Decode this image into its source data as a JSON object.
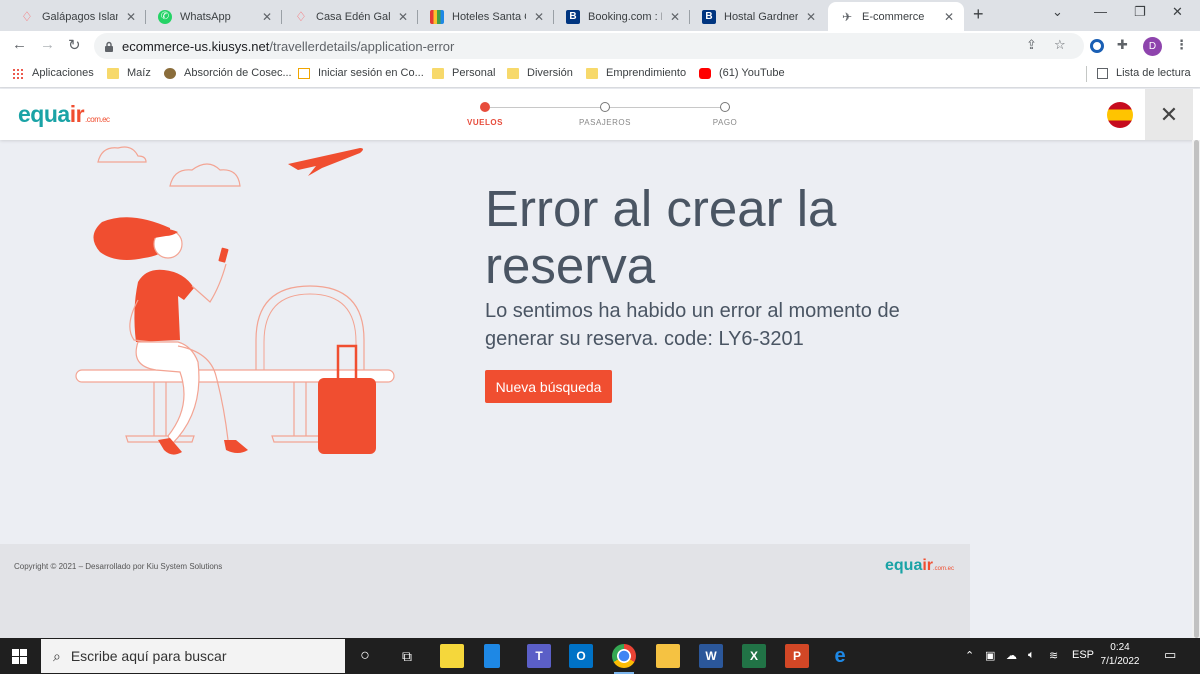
{
  "browser": {
    "tabs": [
      {
        "title": "Galápagos Island",
        "icon": "airbnb-icon"
      },
      {
        "title": "WhatsApp",
        "icon": "whatsapp-icon"
      },
      {
        "title": "Casa Edén Galápa",
        "icon": "airbnb-icon"
      },
      {
        "title": "Hoteles Santa Cr",
        "icon": "hotels-icon"
      },
      {
        "title": "Booking.com : Ho",
        "icon": "booking-icon"
      },
      {
        "title": "Hostal Gardner G",
        "icon": "booking-icon"
      },
      {
        "title": "E-commerce",
        "icon": "plane-icon",
        "active": true
      }
    ],
    "url_host": "ecommerce-us.kiusys.net",
    "url_path": "/travellerdetails/application-error",
    "profile_initial": "D",
    "bookmarks": [
      {
        "label": "Aplicaciones",
        "icon": "apps-grid-icon"
      },
      {
        "label": "Maíz",
        "icon": "folder-icon"
      },
      {
        "label": "Absorción de Cosec...",
        "icon": "seal-icon"
      },
      {
        "label": "Iniciar sesión en Co...",
        "icon": "site-icon"
      },
      {
        "label": "Personal",
        "icon": "folder-icon"
      },
      {
        "label": "Diversión",
        "icon": "folder-icon"
      },
      {
        "label": "Emprendimiento",
        "icon": "folder-icon"
      },
      {
        "label": "(61) YouTube",
        "icon": "youtube-icon"
      }
    ],
    "reading_list": "Lista de lectura"
  },
  "site": {
    "logo_main": "equa",
    "logo_air": "ir",
    "logo_tld": ".com.ec",
    "steps": [
      {
        "label": "VUELOS",
        "active": true
      },
      {
        "label": "PASAJEROS",
        "active": false
      },
      {
        "label": "PAGO",
        "active": false
      }
    ],
    "language_flag": "spain-flag-icon"
  },
  "error": {
    "title": "Error al crear la reserva",
    "message": "Lo sentimos ha habido un error al momento de generar su reserva. code: LY6-3201",
    "button": "Nueva búsqueda"
  },
  "footer": {
    "copyright": "Copyright © 2021 – Desarrollado por Kiu System Solutions"
  },
  "taskbar": {
    "search_placeholder": "Escribe aquí para buscar",
    "language": "ESP",
    "time": "0:24",
    "date": "7/1/2022"
  },
  "colors": {
    "accent": "#f04e30",
    "brand_teal": "#1aa3a6",
    "heading": "#4a5563"
  }
}
